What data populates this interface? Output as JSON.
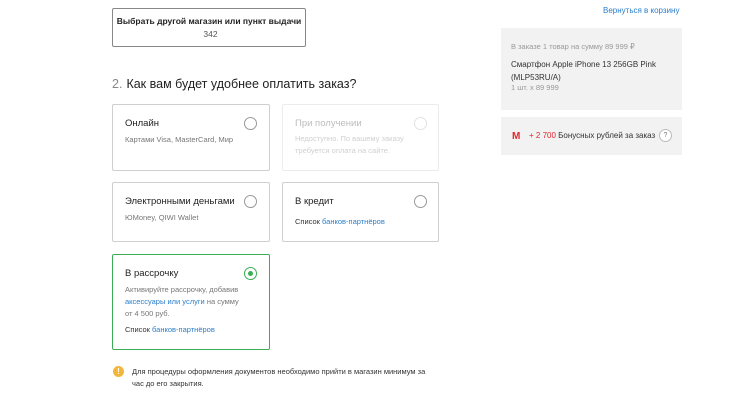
{
  "store_button": {
    "label": "Выбрать другой магазин или пункт выдачи",
    "count": "342"
  },
  "back_link": "Вернуться в корзину",
  "step": {
    "num": "2.",
    "title": "Как вам будет удобнее оплатить заказ?"
  },
  "payment": {
    "online": {
      "title": "Онлайн",
      "desc": "Картами Visa, MasterCard, Мир"
    },
    "on_receipt": {
      "title": "При получении",
      "desc": "Недоступно. По вашему заказу требуется оплата на сайте."
    },
    "emoney": {
      "title": "Электронными деньгами",
      "desc": "ЮMoney, QIWI Wallet"
    },
    "credit": {
      "title": "В кредит",
      "desc_prefix": "Список ",
      "desc_link": "банков-партнёров"
    },
    "installment": {
      "title": "В рассрочку",
      "desc_part1": "Активируйте рассрочку, добавив",
      "desc_link": "аксессуары или услуги",
      "desc_part2": " на сумму",
      "desc_part3": "от 4 500 руб.",
      "list_prefix": "Список ",
      "list_link": "банков-партнёров"
    }
  },
  "note": {
    "icon": "!",
    "text": "Для процедуры оформления документов необходимо прийти в магазин минимум за час до его закрытия."
  },
  "summary": {
    "line1": "В заказе 1 товар на сумму 89 999 ₽",
    "product": "Смартфон Apple iPhone 13 256GB Pink (MLP53RU/A)",
    "qty": "1 шт. x 89 999"
  },
  "bonus": {
    "logo": "M",
    "amount": "+ 2 700",
    "text": " Бонусных рублей за заказ",
    "help": "?"
  },
  "colors": {
    "accent_green": "#3bae55",
    "link_blue": "#2a7ecb",
    "brand_red": "#e3262b",
    "warning": "#f3b63b"
  }
}
